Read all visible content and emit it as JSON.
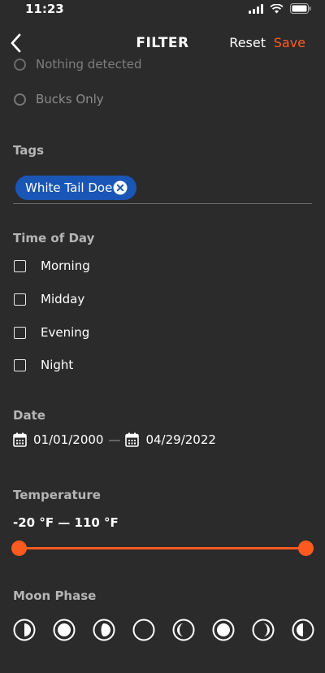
{
  "status": {
    "time": "11:23"
  },
  "nav": {
    "title": "FILTER",
    "reset_label": "Reset",
    "save_label": "Save",
    "accent_color": "#ff5a1f"
  },
  "detection_options": [
    {
      "label": "Nothing detected"
    },
    {
      "label": "Bucks Only"
    }
  ],
  "tags": {
    "title": "Tags",
    "chips": [
      {
        "label": "White Tail Doe",
        "color": "#1a56b5"
      }
    ]
  },
  "time_of_day": {
    "title": "Time of Day",
    "options": [
      {
        "label": "Morning",
        "checked": false
      },
      {
        "label": "Midday",
        "checked": false
      },
      {
        "label": "Evening",
        "checked": false
      },
      {
        "label": "Night",
        "checked": false
      }
    ]
  },
  "date": {
    "title": "Date",
    "start": "01/01/2000",
    "separator": "—",
    "end": "04/29/2022"
  },
  "temperature": {
    "title": "Temperature",
    "range_text": "-20 °F — 110 °F",
    "min": -20,
    "max": 110,
    "unit": "°F"
  },
  "moon_phase": {
    "title": "Moon Phase",
    "phases": [
      {
        "icon": "first-quarter-moon-icon"
      },
      {
        "icon": "full-moon-icon"
      },
      {
        "icon": "waxing-gibbous-moon-icon"
      },
      {
        "icon": "new-moon-icon"
      },
      {
        "icon": "waning-crescent-moon-icon"
      },
      {
        "icon": "waning-gibbous-moon-icon"
      },
      {
        "icon": "waxing-crescent-moon-icon"
      },
      {
        "icon": "last-quarter-moon-icon"
      }
    ]
  }
}
